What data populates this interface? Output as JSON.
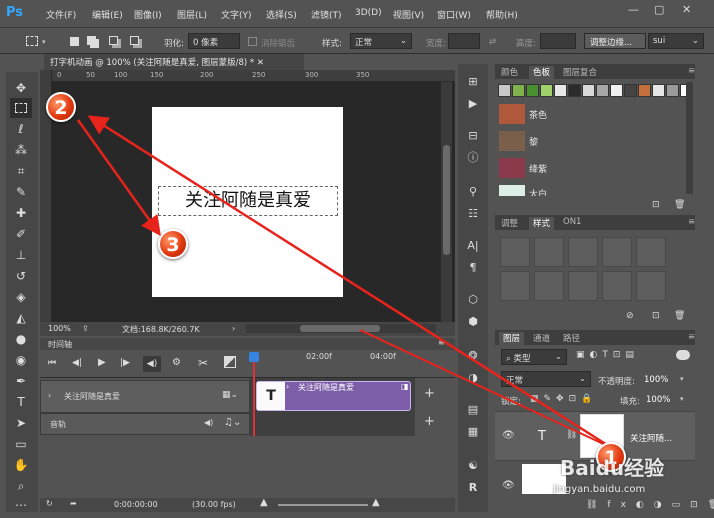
{
  "app": {
    "logo": "Ps"
  },
  "menu": [
    "文件(F)",
    "编辑(E)",
    "图像(I)",
    "图层(L)",
    "文字(Y)",
    "选择(S)",
    "滤镜(T)",
    "3D(D)",
    "视图(V)",
    "窗口(W)",
    "帮助(H)"
  ],
  "options": {
    "feather_label": "羽化:",
    "feather_value": "0 像素",
    "antialias": "消除锯齿",
    "style_label": "样式:",
    "style_value": "正常",
    "width_label": "宽度:",
    "height_label": "高度:",
    "refine_edge": "调整边缘...",
    "workspace": "sui"
  },
  "document": {
    "tab_title": "打字机动画 @ 100% (关注阿随是真爱, 图层蒙版/8) *",
    "ruler_marks": [
      "0",
      "50",
      "100",
      "150",
      "200",
      "250",
      "300",
      "350"
    ],
    "canvas_text": "关注阿随是真爱",
    "zoom": "100%",
    "doc_info": "文档:168.8K/260.7K"
  },
  "timeline": {
    "title": "时间轴",
    "time_marks": [
      "02:00f",
      "04:00f"
    ],
    "layer_name": "关注阿随是真爱",
    "audio_label": "音轨",
    "clip_label": "关注阿随是真爱",
    "clip_icon": "T",
    "timecode": "0:00:00:00",
    "fps": "(30.00 fps)"
  },
  "color_panel": {
    "tabs": [
      "颜色",
      "色板",
      "图层复合"
    ],
    "active_tab": "色板",
    "swatch_colors": [
      "#c8c8c8",
      "#7fb24a",
      "#4a8f2f",
      "#a0d26a",
      "#e8e8e8",
      "#2b2b2b",
      "#d9d9d9",
      "#a6a6a6",
      "#f0f0f0",
      "#444444",
      "#c4703e",
      "#e6e6e6",
      "#9a9a9a",
      "#ffffff"
    ],
    "named": [
      {
        "name": "茶色",
        "color": "#b0583b"
      },
      {
        "name": "黎",
        "color": "#7a5f4a"
      },
      {
        "name": "绛紫",
        "color": "#8b3a4c"
      },
      {
        "name": "太白",
        "color": "#dceee6"
      }
    ]
  },
  "adjust_panel": {
    "tabs": [
      "调整",
      "样式",
      "ON1"
    ],
    "active_tab": "样式"
  },
  "layers_panel": {
    "tabs": [
      "图层",
      "通道",
      "路径"
    ],
    "kind_label": "类型",
    "blend_mode": "正常",
    "opacity_label": "不透明度:",
    "opacity_value": "100%",
    "lock_label": "锁定:",
    "fill_label": "填充:",
    "fill_value": "100%",
    "layer1_name": "关注阿随...",
    "layer1_icon": "T"
  },
  "annotations": {
    "badge1": "1",
    "badge2": "2",
    "badge3": "3",
    "arrow_color": "#e8231b"
  },
  "watermark": {
    "brand": "Baidu经验",
    "url": "jingyan.baidu.com"
  }
}
